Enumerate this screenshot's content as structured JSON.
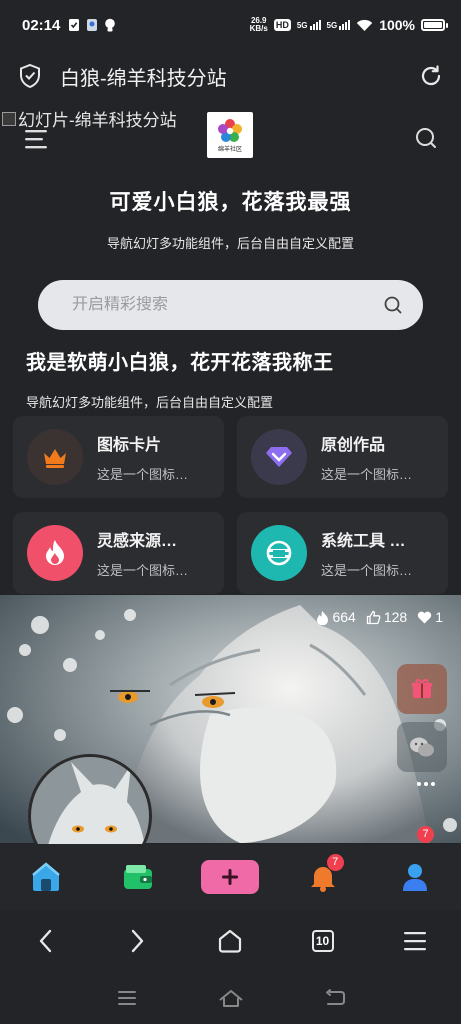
{
  "status_bar": {
    "time": "02:14",
    "net_speed_value": "26.9",
    "net_speed_unit": "KB/s",
    "hd_label": "HD",
    "sim1_label": "5G",
    "sim2_label": "5G",
    "battery": "100%"
  },
  "browser": {
    "page_title": "白狼-绵羊科技分站",
    "tab_count": "10"
  },
  "header": {
    "slide_alt_text": "幻灯片-绵羊科技分站",
    "logo_text": "绵羊社区"
  },
  "hero": {
    "title": "可爱小白狼，花落我最强",
    "subtitle": "导航幻灯多功能组件，后台自由自定义配置"
  },
  "search": {
    "placeholder": "开启精彩搜索"
  },
  "section": {
    "title": "我是软萌小白狼，花开花落我称王",
    "subtitle": "导航幻灯多功能组件，后台自由自定义配置"
  },
  "cards": [
    {
      "title": "图标卡片",
      "desc": "这是一个图标…",
      "icon": "crown-icon",
      "color": "#3a3331"
    },
    {
      "title": "原创作品",
      "desc": "这是一个图标…",
      "icon": "diamond-icon",
      "color": "#3a3a4c"
    },
    {
      "title": "灵感来源…",
      "desc": "这是一个图标…",
      "icon": "flame-icon",
      "color": "#f0506a"
    },
    {
      "title": "系统工具 …",
      "desc": "这是一个图标…",
      "icon": "tool-icon",
      "color": "#1fb8b0"
    }
  ],
  "post": {
    "views": "664",
    "likes": "128",
    "favorites": "1"
  },
  "tabbar": {
    "notification_badge": "7",
    "profile_badge": "7"
  },
  "colors": {
    "background": "#232427",
    "card": "#2c2d31",
    "accent_pink": "#f06aa8",
    "badge": "#f04050"
  }
}
